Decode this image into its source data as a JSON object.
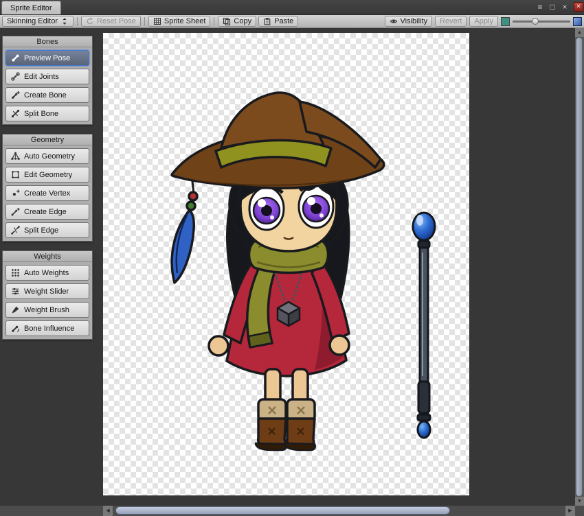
{
  "window": {
    "tab": "Sprite Editor",
    "menu_glyph": "≡",
    "maximize_glyph": "□",
    "close_glyph": "×"
  },
  "toolbar": {
    "mode": "Skinning Editor",
    "reset_pose": "Reset Pose",
    "sprite_sheet": "Sprite Sheet",
    "copy": "Copy",
    "paste": "Paste",
    "visibility": "Visibility",
    "revert": "Revert",
    "apply": "Apply"
  },
  "panels": [
    {
      "title": "Bones",
      "items": [
        {
          "label": "Preview Pose"
        },
        {
          "label": "Edit Joints"
        },
        {
          "label": "Create Bone"
        },
        {
          "label": "Split Bone"
        }
      ]
    },
    {
      "title": "Geometry",
      "items": [
        {
          "label": "Auto Geometry"
        },
        {
          "label": "Edit Geometry"
        },
        {
          "label": "Create Vertex"
        },
        {
          "label": "Create Edge"
        },
        {
          "label": "Split Edge"
        }
      ]
    },
    {
      "title": "Weights",
      "items": [
        {
          "label": "Auto Weights"
        },
        {
          "label": "Weight Slider"
        },
        {
          "label": "Weight Brush"
        },
        {
          "label": "Bone Influence"
        }
      ]
    }
  ],
  "colors": {
    "selected_tool": "#5a6478",
    "focus_ring": "#4377d0",
    "color_swatch": "#3f8f83"
  }
}
